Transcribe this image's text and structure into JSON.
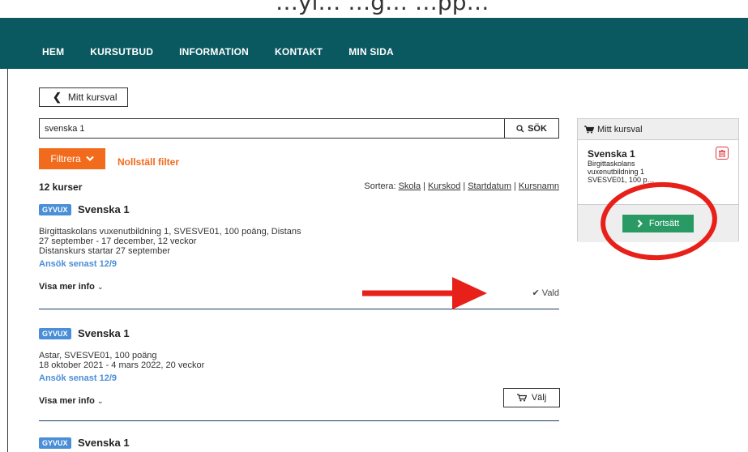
{
  "header": {
    "top_text": "…yl… …g… …pp…"
  },
  "nav": {
    "items": [
      "HEM",
      "KURSUTBUD",
      "INFORMATION",
      "KONTAKT",
      "MIN SIDA"
    ]
  },
  "back": {
    "label": "Mitt kursval"
  },
  "search": {
    "value": "svenska 1",
    "button_label": "SÖK"
  },
  "filter": {
    "label": "Filtrera",
    "reset_label": "Nollställ filter"
  },
  "results": {
    "count": "12 kurser",
    "sort_label": "Sortera:",
    "sort_options": [
      "Skola",
      "Kurskod",
      "Startdatum",
      "Kursnamn"
    ]
  },
  "courses": [
    {
      "badge": "GYVUX",
      "title": "Svenska 1",
      "lines": [
        "Birgittaskolans vuxenutbildning 1, SVESVE01, 100 poäng, Distans",
        "27 september - 17 december, 12 veckor",
        "Distanskurs startar 27 september"
      ],
      "apply": "Ansök senast 12/9",
      "more_info": "Visa mer info",
      "status": "Vald"
    },
    {
      "badge": "GYVUX",
      "title": "Svenska 1",
      "lines": [
        "Astar, SVESVE01, 100 poäng",
        "18 oktober 2021 - 4 mars 2022, 20 veckor"
      ],
      "apply": "Ansök senast 12/9",
      "more_info": "Visa mer info",
      "button": "Välj"
    },
    {
      "badge": "GYVUX",
      "title": "Svenska 1"
    }
  ],
  "cart": {
    "header": "Mitt kursval",
    "course_title": "Svenska 1",
    "details": [
      "Birgittaskolans",
      "vuxenutbildning 1",
      "SVESVE01, 100 p…"
    ],
    "continue_label": "Fortsätt"
  },
  "colors": {
    "nav_bg": "#0b5960",
    "filter_orange": "#f26a1b",
    "badge_blue": "#4a8ed8",
    "continue_green": "#2a9a64",
    "annotation_red": "#e8201a"
  }
}
